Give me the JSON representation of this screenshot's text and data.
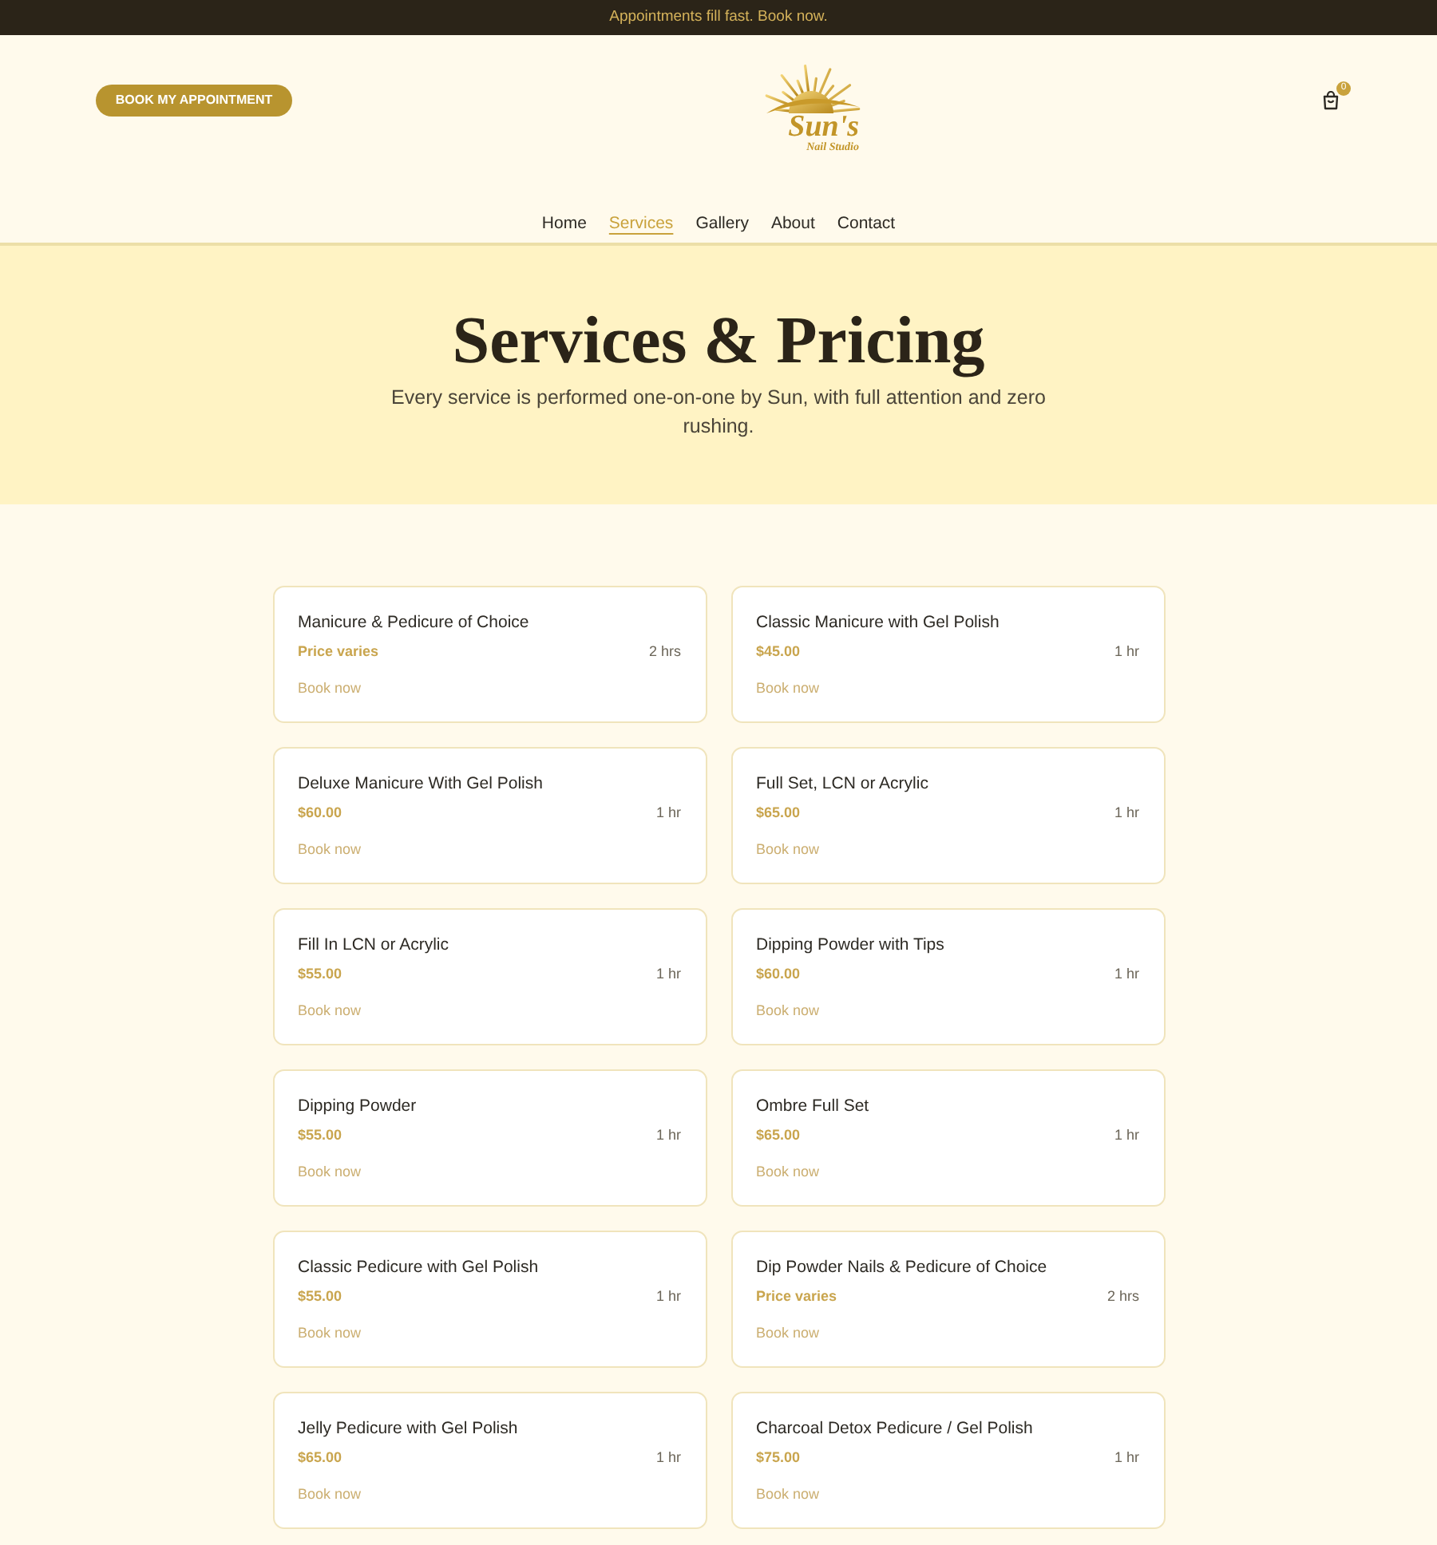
{
  "announcement": "Appointments fill fast. Book now.",
  "header": {
    "book_button": "BOOK MY APPOINTMENT",
    "logo": {
      "title": "Sun's",
      "subtitle": "Nail Studio"
    },
    "cart": {
      "count": "0"
    }
  },
  "nav": [
    {
      "label": "Home",
      "selected": false
    },
    {
      "label": "Services",
      "selected": true
    },
    {
      "label": "Gallery",
      "selected": false
    },
    {
      "label": "About",
      "selected": false
    },
    {
      "label": "Contact",
      "selected": false
    }
  ],
  "hero": {
    "title": "Services & Pricing",
    "subtitle": "Every service is performed one-on-one by Sun, with full attention and zero rushing."
  },
  "services": [
    {
      "name": "Manicure & Pedicure of Choice",
      "price": "Price varies",
      "duration": "2 hrs",
      "action": "Book now"
    },
    {
      "name": "Classic Manicure with Gel Polish",
      "price": "$45.00",
      "duration": "1 hr",
      "action": "Book now"
    },
    {
      "name": "Deluxe Manicure With Gel Polish",
      "price": "$60.00",
      "duration": "1 hr",
      "action": "Book now"
    },
    {
      "name": "Full Set, LCN or Acrylic",
      "price": "$65.00",
      "duration": "1 hr",
      "action": "Book now"
    },
    {
      "name": "Fill In LCN or Acrylic",
      "price": "$55.00",
      "duration": "1 hr",
      "action": "Book now"
    },
    {
      "name": "Dipping Powder with Tips",
      "price": "$60.00",
      "duration": "1 hr",
      "action": "Book now"
    },
    {
      "name": "Dipping Powder",
      "price": "$55.00",
      "duration": "1 hr",
      "action": "Book now"
    },
    {
      "name": "Ombre Full Set",
      "price": "$65.00",
      "duration": "1 hr",
      "action": "Book now"
    },
    {
      "name": "Classic Pedicure with Gel Polish",
      "price": "$55.00",
      "duration": "1 hr",
      "action": "Book now"
    },
    {
      "name": "Dip Powder Nails & Pedicure of Choice",
      "price": "Price varies",
      "duration": "2 hrs",
      "action": "Book now"
    },
    {
      "name": "Jelly Pedicure with Gel Polish",
      "price": "$65.00",
      "duration": "1 hr",
      "action": "Book now"
    },
    {
      "name": "Charcoal Detox Pedicure / Gel Polish",
      "price": "$75.00",
      "duration": "1 hr",
      "action": "Book now"
    }
  ]
}
